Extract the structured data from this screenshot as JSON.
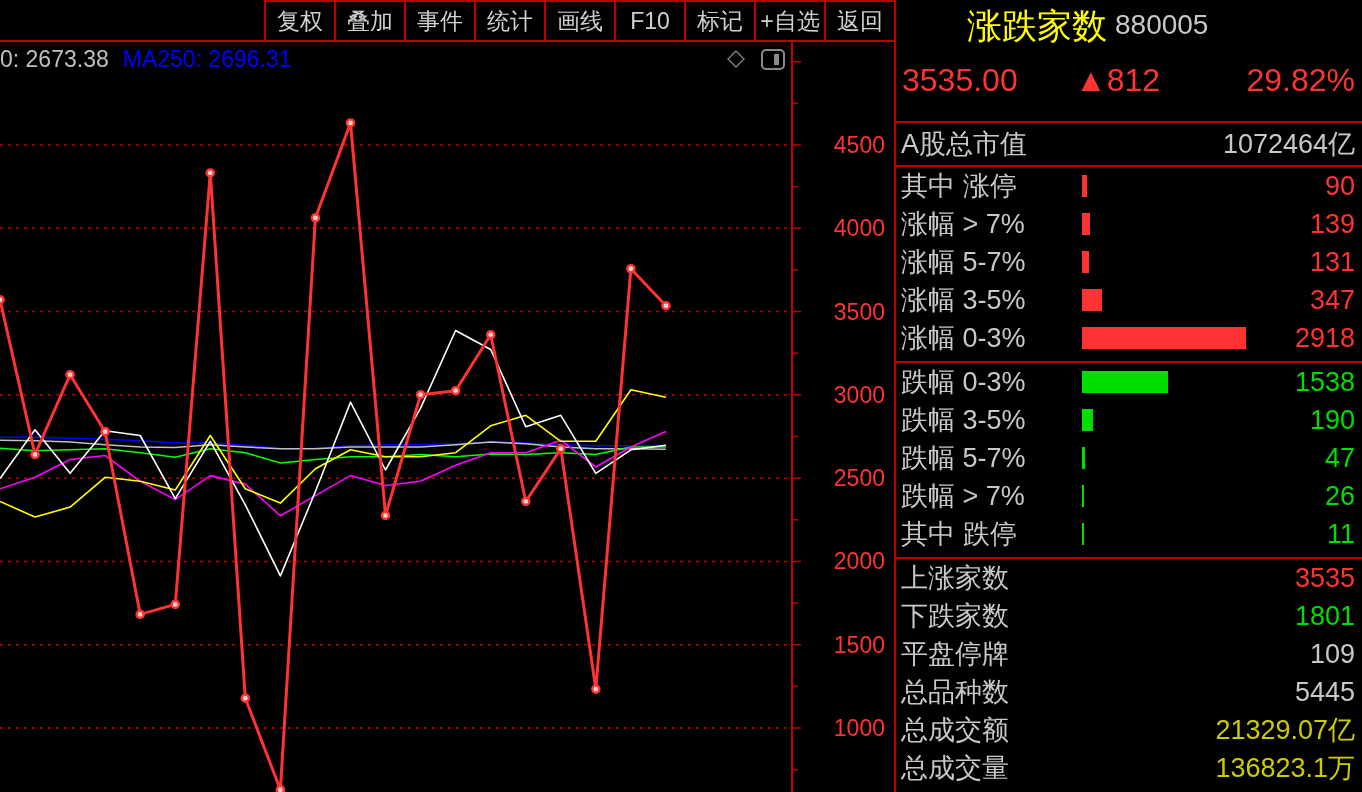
{
  "toolbar": {
    "buttons": [
      "复权",
      "叠加",
      "事件",
      "统计",
      "画线",
      "F10",
      "标记",
      "+自选",
      "返回"
    ]
  },
  "chart": {
    "ma_legend": [
      {
        "text": "0: 2673.38",
        "color": "#c0c0c0"
      },
      {
        "text": "MA250: 2696.31",
        "color": "#0000ff"
      }
    ],
    "chart_data": {
      "type": "line",
      "ylim": [
        616,
        5118
      ],
      "yticks": [
        1000,
        1500,
        2000,
        2500,
        3000,
        3500,
        4000,
        4500
      ],
      "grid": true,
      "series": [
        {
          "color": "#ff3333",
          "marker": "circle",
          "values": [
            3571,
            2642,
            3121,
            2779,
            1682,
            1742,
            4332,
            1179,
            630,
            4062,
            4632,
            2276,
            3001,
            3025,
            3361,
            2360,
            2677,
            1233,
            3757,
            3535
          ]
        },
        {
          "color": "#ffffff",
          "values": [
            2498,
            2790,
            2529,
            2784,
            2756,
            2377,
            2721,
            2340,
            1913,
            2420,
            2956,
            2549,
            2920,
            3386,
            3272,
            2808,
            2877,
            2529,
            2670,
            2697
          ]
        },
        {
          "color": "#ffff00",
          "values": [
            2360,
            2267,
            2326,
            2505,
            2481,
            2429,
            2756,
            2436,
            2350,
            2556,
            2670,
            2628,
            2628,
            2653,
            2814,
            2877,
            2721,
            2721,
            3031,
            2986
          ]
        },
        {
          "color": "#ff00ff",
          "values": [
            2436,
            2505,
            2612,
            2636,
            2481,
            2371,
            2515,
            2464,
            2274,
            2395,
            2515,
            2456,
            2481,
            2577,
            2653,
            2653,
            2728,
            2567,
            2687,
            2780
          ]
        },
        {
          "color": "#00ff00",
          "values": [
            2680,
            2665,
            2670,
            2676,
            2653,
            2625,
            2676,
            2653,
            2591,
            2612,
            2628,
            2628,
            2642,
            2628,
            2645,
            2642,
            2653,
            2642,
            2687,
            2687
          ]
        },
        {
          "color": "#c0c0c0",
          "values": [
            2728,
            2724,
            2717,
            2700,
            2687,
            2684,
            2700,
            2687,
            2676,
            2676,
            2687,
            2687,
            2687,
            2700,
            2717,
            2707,
            2687,
            2676,
            2676,
            2673
          ]
        },
        {
          "color": "#0000ff",
          "values": [
            2746,
            2746,
            2740,
            2733,
            2724,
            2711,
            2711,
            2697,
            2676,
            2680,
            2694,
            2700,
            2700,
            2707,
            2717,
            2711,
            2700,
            2694,
            2694,
            2696
          ]
        }
      ]
    }
  },
  "quote_panel": {
    "title": "涨跌家数",
    "code": "880005",
    "price": "3535.00",
    "change": "▲812",
    "change_pct": "29.82%",
    "market_cap": {
      "label": "A股总市值",
      "value": "1072464亿"
    },
    "breakdown_groups": [
      {
        "color": "#ff3333",
        "rows": [
          {
            "label": "其中 涨停",
            "value": "90"
          },
          {
            "label": "涨幅 > 7%",
            "value": "139"
          },
          {
            "label": "涨幅 5-7%",
            "value": "131"
          },
          {
            "label": "涨幅 3-5%",
            "value": "347"
          },
          {
            "label": "涨幅 0-3%",
            "value": "2918"
          }
        ]
      },
      {
        "color": "#00dd00",
        "rows": [
          {
            "label": "跌幅 0-3%",
            "value": "1538"
          },
          {
            "label": "跌幅 3-5%",
            "value": "190"
          },
          {
            "label": "跌幅 5-7%",
            "value": "47"
          },
          {
            "label": "跌幅 > 7%",
            "value": "26"
          },
          {
            "label": "其中 跌停",
            "value": "11"
          }
        ]
      }
    ],
    "summary": [
      {
        "label": "上涨家数",
        "value": "3535",
        "color": "#ff3333"
      },
      {
        "label": "下跌家数",
        "value": "1801",
        "color": "#00dd00"
      },
      {
        "label": "平盘停牌",
        "value": "109",
        "color": "#c8c8c8"
      },
      {
        "label": "总品种数",
        "value": "5445",
        "color": "#c8c8c8"
      },
      {
        "label": "总成交额",
        "value": "21329.07亿",
        "color": "#cccc00"
      },
      {
        "label": "总成交量",
        "value": "136823.1万",
        "color": "#cccc00"
      }
    ]
  }
}
